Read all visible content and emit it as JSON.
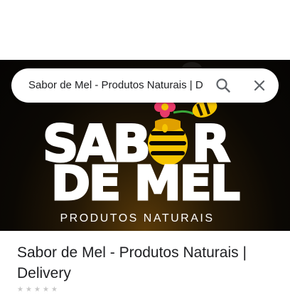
{
  "search": {
    "query": "Sabor de Mel - Produtos Naturais | D"
  },
  "banner": {
    "logo_line1_left": "SAB",
    "logo_line1_right": "R",
    "logo_line2": "DE MEL",
    "tagline": "PRODUTOS NATURAIS",
    "colors": {
      "honey": "#f5c400",
      "honey_dark": "#e0a000",
      "text": "#ffffff",
      "background": "#0b0804",
      "flower": "#e83a6a"
    }
  },
  "place": {
    "title": "Sabor de Mel - Produtos Naturais | Delivery"
  },
  "icons": [
    "search-icon",
    "close-icon",
    "honeycomb-icon",
    "flower-icon",
    "bee-icon"
  ]
}
